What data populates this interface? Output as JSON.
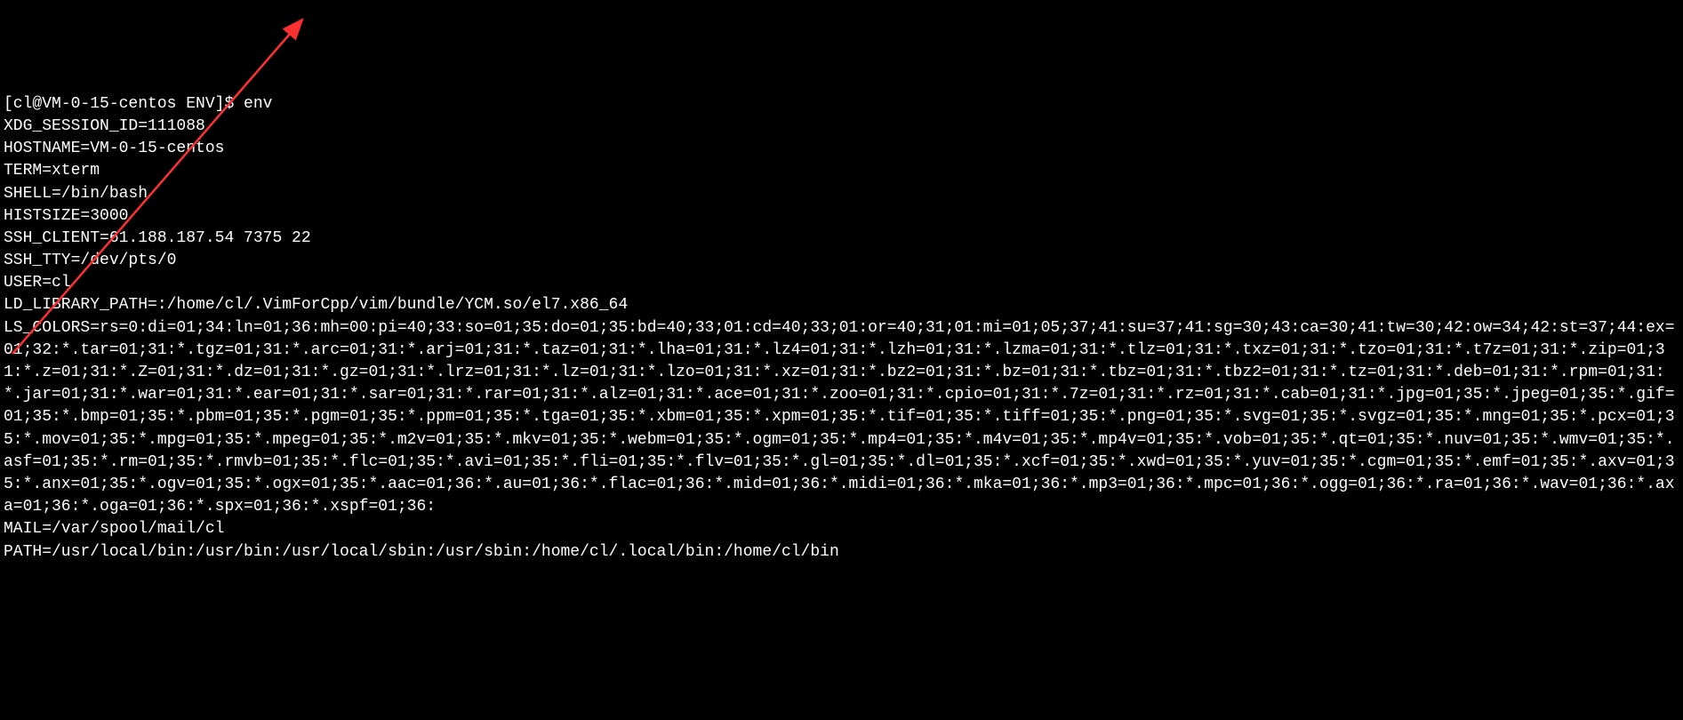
{
  "terminal": {
    "prompt": "[cl@VM-0-15-centos ENV]$ ",
    "command": "env",
    "lines": [
      "XDG_SESSION_ID=111088",
      "HOSTNAME=VM-0-15-centos",
      "TERM=xterm",
      "SHELL=/bin/bash",
      "HISTSIZE=3000",
      "SSH_CLIENT=61.188.187.54 7375 22",
      "SSH_TTY=/dev/pts/0",
      "USER=cl",
      "LD_LIBRARY_PATH=:/home/cl/.VimForCpp/vim/bundle/YCM.so/el7.x86_64",
      "LS_COLORS=rs=0:di=01;34:ln=01;36:mh=00:pi=40;33:so=01;35:do=01;35:bd=40;33;01:cd=40;33;01:or=40;31;01:mi=01;05;37;41:su=37;41:sg=30;43:ca=30;41:tw=30;42:ow=34;42:st=37;44:ex=01;32:*.tar=01;31:*.tgz=01;31:*.arc=01;31:*.arj=01;31:*.taz=01;31:*.lha=01;31:*.lz4=01;31:*.lzh=01;31:*.lzma=01;31:*.tlz=01;31:*.txz=01;31:*.tzo=01;31:*.t7z=01;31:*.zip=01;31:*.z=01;31:*.Z=01;31:*.dz=01;31:*.gz=01;31:*.lrz=01;31:*.lz=01;31:*.lzo=01;31:*.xz=01;31:*.bz2=01;31:*.bz=01;31:*.tbz=01;31:*.tbz2=01;31:*.tz=01;31:*.deb=01;31:*.rpm=01;31:*.jar=01;31:*.war=01;31:*.ear=01;31:*.sar=01;31:*.rar=01;31:*.alz=01;31:*.ace=01;31:*.zoo=01;31:*.cpio=01;31:*.7z=01;31:*.rz=01;31:*.cab=01;31:*.jpg=01;35:*.jpeg=01;35:*.gif=01;35:*.bmp=01;35:*.pbm=01;35:*.pgm=01;35:*.ppm=01;35:*.tga=01;35:*.xbm=01;35:*.xpm=01;35:*.tif=01;35:*.tiff=01;35:*.png=01;35:*.svg=01;35:*.svgz=01;35:*.mng=01;35:*.pcx=01;35:*.mov=01;35:*.mpg=01;35:*.mpeg=01;35:*.m2v=01;35:*.mkv=01;35:*.webm=01;35:*.ogm=01;35:*.mp4=01;35:*.m4v=01;35:*.mp4v=01;35:*.vob=01;35:*.qt=01;35:*.nuv=01;35:*.wmv=01;35:*.asf=01;35:*.rm=01;35:*.rmvb=01;35:*.flc=01;35:*.avi=01;35:*.fli=01;35:*.flv=01;35:*.gl=01;35:*.dl=01;35:*.xcf=01;35:*.xwd=01;35:*.yuv=01;35:*.cgm=01;35:*.emf=01;35:*.axv=01;35:*.anx=01;35:*.ogv=01;35:*.ogx=01;35:*.aac=01;36:*.au=01;36:*.flac=01;36:*.mid=01;36:*.midi=01;36:*.mka=01;36:*.mp3=01;36:*.mpc=01;36:*.ogg=01;36:*.ra=01;36:*.wav=01;36:*.axa=01;36:*.oga=01;36:*.spx=01;36:*.xspf=01;36:",
      "MAIL=/var/spool/mail/cl",
      "PATH=/usr/local/bin:/usr/bin:/usr/local/sbin:/usr/sbin:/home/cl/.local/bin:/home/cl/bin"
    ]
  },
  "annotation": {
    "arrow_color": "#ff3030"
  }
}
